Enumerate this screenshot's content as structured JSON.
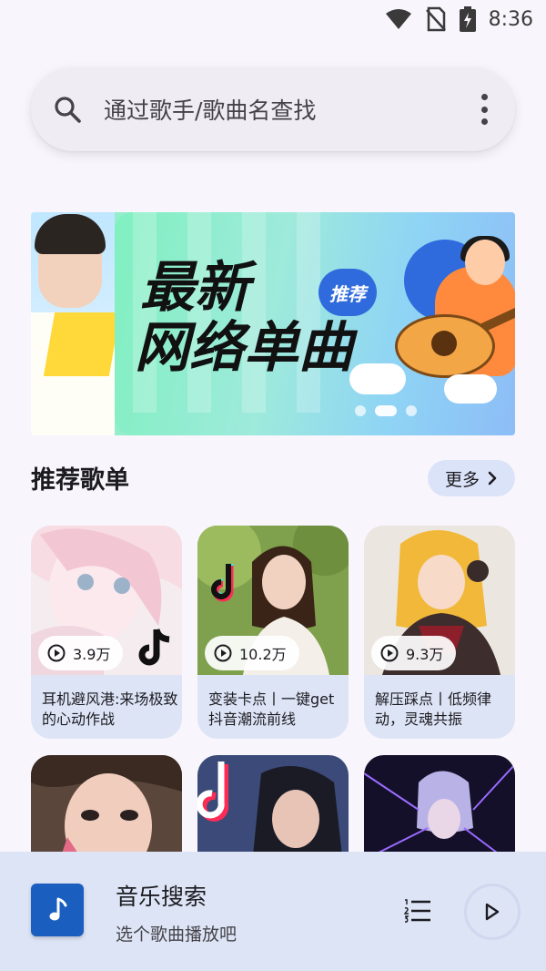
{
  "status_bar": {
    "time": "8:36",
    "icons": [
      "wifi-icon",
      "no-sim-icon",
      "battery-charging-icon"
    ]
  },
  "search": {
    "placeholder": "通过歌手/歌曲名查找",
    "icon": "search-icon",
    "menu_icon": "more-vert-icon"
  },
  "banner": {
    "title_line1": "最新",
    "title_line2": "网络单曲",
    "tag": "推荐",
    "pages": 3,
    "active_page": 2
  },
  "section": {
    "title": "推荐歌单",
    "more_label": "更多"
  },
  "playlists": [
    {
      "plays": "3.9万",
      "title": "耳机避风港:来场极致的心动作战"
    },
    {
      "plays": "10.2万",
      "title": "变装卡点丨一键get抖音潮流前线"
    },
    {
      "plays": "9.3万",
      "title": "解压踩点丨低频律动，灵魂共振"
    }
  ],
  "player": {
    "title": "音乐搜索",
    "subtitle": "选个歌曲播放吧",
    "icons": [
      "music-note-icon",
      "queue-icon",
      "play-icon"
    ]
  },
  "colors": {
    "accent": "#1a5fbf",
    "chip_bg": "#dbe3f9",
    "player_bg": "#dde4f6"
  }
}
